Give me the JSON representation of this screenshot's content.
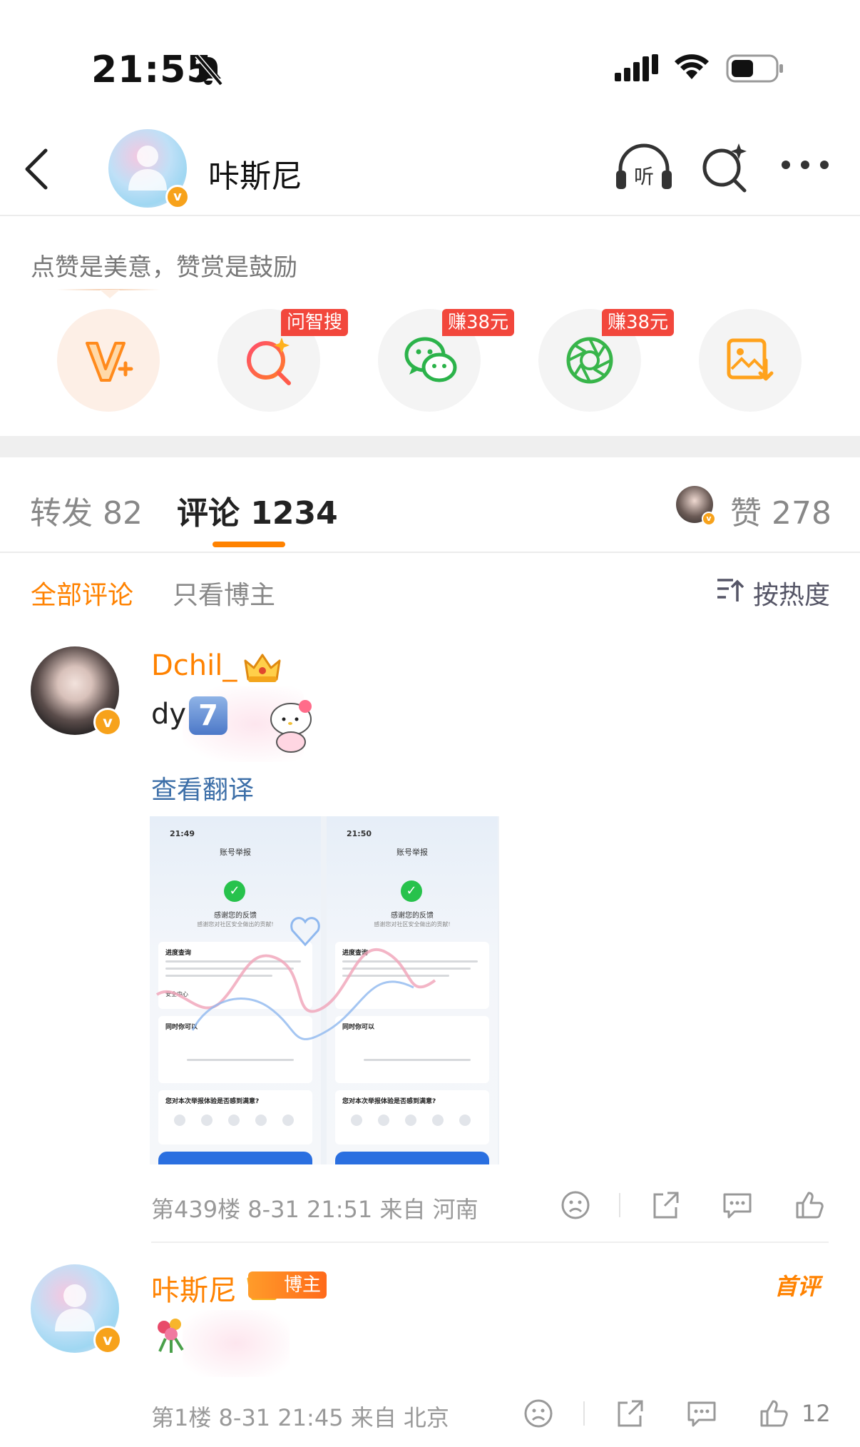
{
  "status_bar": {
    "time": "21:55"
  },
  "nav": {
    "title": "咔斯尼"
  },
  "reward": {
    "hint": "点赞是美意，赞赏是鼓励",
    "actions": [
      {
        "name": "v-plus",
        "tag": ""
      },
      {
        "name": "ask-zhisou",
        "tag": "问智搜"
      },
      {
        "name": "wechat",
        "tag": "赚38元"
      },
      {
        "name": "moments",
        "tag": "赚38元"
      },
      {
        "name": "save-image",
        "tag": ""
      }
    ]
  },
  "tabs": {
    "repost": "转发 82",
    "comment": "评论 1234",
    "likes": "赞 278"
  },
  "filters": {
    "all": "全部评论",
    "blogger_only": "只看博主",
    "sort": "按热度"
  },
  "comments": [
    {
      "user": "Dchil_",
      "text": "dy",
      "badge": "7",
      "translate": "查看翻译",
      "meta": "第439楼 8-31 21:51 来自 河南",
      "image": {
        "left": {
          "time": "21:49",
          "title": "账号举报"
        },
        "right": {
          "time": "21:50",
          "title": "账号举报"
        },
        "thanks": "感谢您的反馈",
        "thanks_sub": "感谢您对社区安全做出的贡献!",
        "card1_title": "进度查询",
        "security_center": "安全中心",
        "card2_title": "同时你可以",
        "card3_title": "您对本次举报体验是否感到满意?"
      }
    },
    {
      "user": "咔斯尼",
      "blogger_badge": "博主",
      "first_comment": "首评",
      "meta": "第1楼 8-31 21:45 来自 北京",
      "likes": "12"
    }
  ],
  "colors": {
    "accent": "#ff8200",
    "link": "#3d6fa8",
    "tag_red": "#f2473c",
    "verified": "#f7a21b"
  }
}
